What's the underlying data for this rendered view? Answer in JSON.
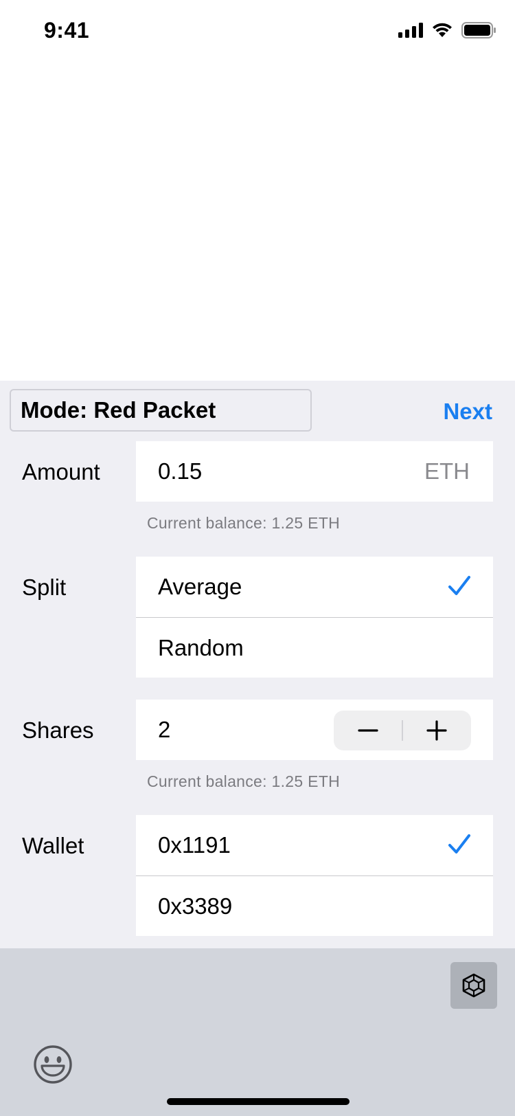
{
  "status_bar": {
    "time": "9:41"
  },
  "header": {
    "mode_label": "Mode: Red Packet",
    "next_label": "Next"
  },
  "amount": {
    "label": "Amount",
    "value": "0.15",
    "unit": "ETH",
    "helper": "Current balance: 1.25 ETH"
  },
  "split": {
    "label": "Split",
    "options": [
      "Average",
      "Random"
    ],
    "selected": "Average"
  },
  "shares": {
    "label": "Shares",
    "value": "2",
    "helper": "Current balance: 1.25 ETH"
  },
  "wallet": {
    "label": "Wallet",
    "options": [
      "0x1191",
      "0x3389"
    ],
    "selected": "0x1191"
  },
  "icons": {
    "check": "checkmark-icon",
    "minus": "minus-icon",
    "plus": "plus-icon",
    "cube": "cube-icon",
    "emoji": "smiley-icon"
  },
  "colors": {
    "accent": "#1a7ff0",
    "panel_bg": "#efeff4",
    "keyboard_bg": "#d2d5dc"
  }
}
